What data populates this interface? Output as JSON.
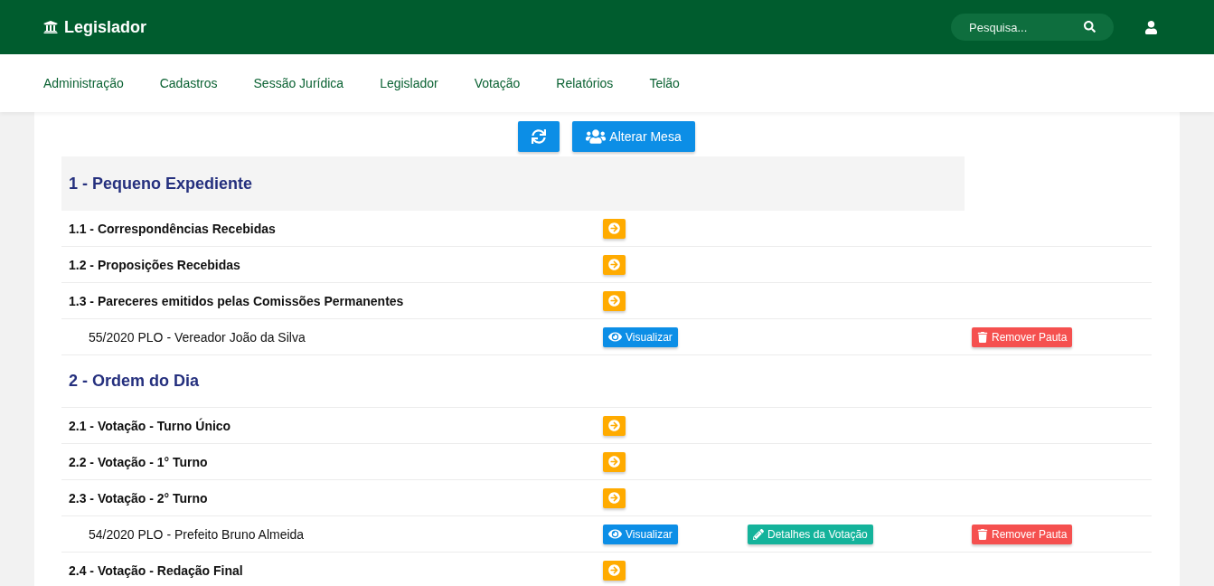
{
  "brand": {
    "title": "Legislador"
  },
  "search": {
    "placeholder": "Pesquisa..."
  },
  "nav": [
    {
      "label": "Administração"
    },
    {
      "label": "Cadastros"
    },
    {
      "label": "Sessão Jurídica"
    },
    {
      "label": "Legislador"
    },
    {
      "label": "Votação"
    },
    {
      "label": "Relatórios"
    },
    {
      "label": "Telão"
    }
  ],
  "toolbar": {
    "change_board": "Alterar Mesa"
  },
  "sections": [
    {
      "title": "1 - Pequeno Expediente",
      "highlighted": true,
      "rows": [
        {
          "kind": "subsection",
          "text": "1.1 - Correspondências Recebidas"
        },
        {
          "kind": "subsection",
          "text": "1.2 - Proposições Recebidas"
        },
        {
          "kind": "subsection",
          "text": "1.3 - Pareceres emitidos pelas Comissões Permanentes"
        },
        {
          "kind": "item",
          "text": "55/2020 PLO - Vereador João da Silva",
          "actions": [
            {
              "kind": "view",
              "label": "Visualizar"
            },
            {
              "kind": "remove",
              "label": "Remover Pauta"
            }
          ]
        }
      ]
    },
    {
      "title": "2 - Ordem do Dia",
      "highlighted": false,
      "rows": [
        {
          "kind": "subsection",
          "text": "2.1 - Votação - Turno Único"
        },
        {
          "kind": "subsection",
          "text": "2.2 - Votação - 1° Turno"
        },
        {
          "kind": "subsection",
          "text": "2.3 - Votação - 2° Turno"
        },
        {
          "kind": "item",
          "text": "54/2020 PLO - Prefeito Bruno Almeida",
          "actions": [
            {
              "kind": "view",
              "label": "Visualizar"
            },
            {
              "kind": "details",
              "label": "Detalhes da Votação"
            },
            {
              "kind": "remove",
              "label": "Remover Pauta"
            }
          ]
        },
        {
          "kind": "subsection",
          "text": "2.4 - Votação - Redação Final"
        }
      ]
    }
  ]
}
